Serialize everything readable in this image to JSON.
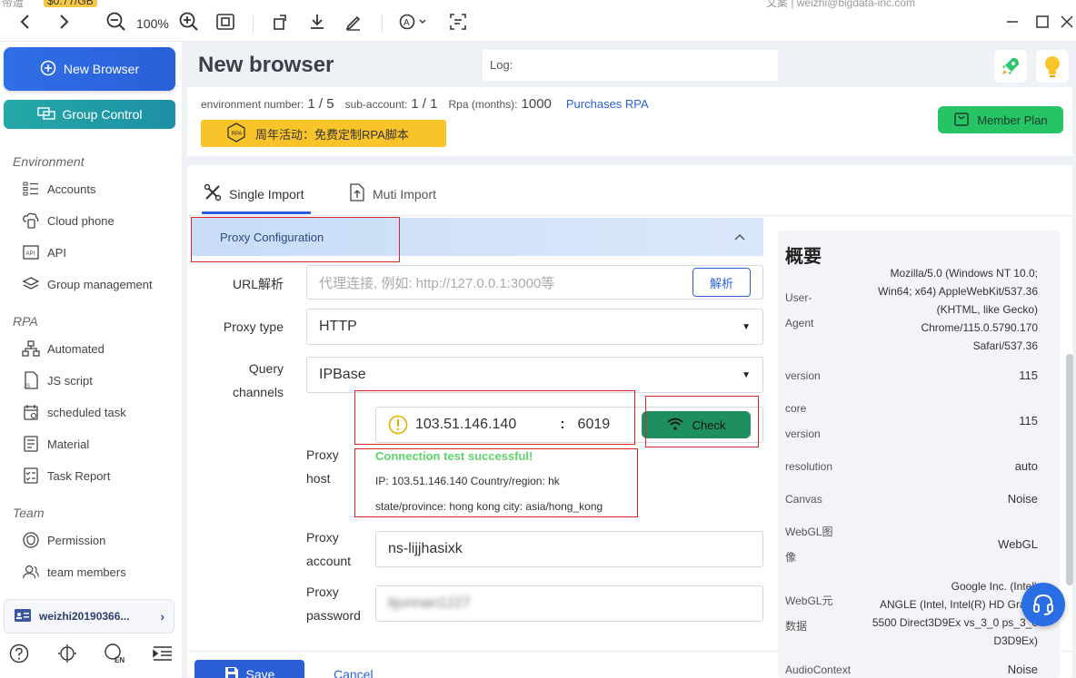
{
  "topbar": {
    "ghost_left": "帝遭",
    "ghost_price": "$0.77/GB",
    "ghost_right": "文案  |  weizhi@bigdata-inc.com",
    "zoom": "100%"
  },
  "sidebar": {
    "new_browser": "New Browser",
    "group_control": "Group Control",
    "sections": {
      "environment": "Environment",
      "rpa": "RPA",
      "team": "Team"
    },
    "items": {
      "accounts": "Accounts",
      "cloud_phone": "Cloud phone",
      "api": "API",
      "group_management": "Group management",
      "automated": "Automated",
      "js_script": "JS script",
      "scheduled_task": "scheduled task",
      "material": "Material",
      "task_report": "Task Report",
      "permission": "Permission",
      "team_members": "team members"
    },
    "user": "weizhi20190366..."
  },
  "header": {
    "title": "New browser",
    "log_label": "Log:"
  },
  "info": {
    "env_label": "environment number:",
    "env_value": "1 / 5",
    "sub_label": "sub-account:",
    "sub_value": "1 / 1",
    "rpa_label": "Rpa (months):",
    "rpa_value": "1000",
    "purchase_link": "Purchases RPA",
    "promo_text": "周年活动：免费定制RPA脚本",
    "member_plan": "Member Plan"
  },
  "tabs": {
    "single": "Single Import",
    "muti": "Muti Import"
  },
  "form": {
    "proxy_config": "Proxy Configuration",
    "url_label": "URL解析",
    "url_placeholder": "代理连接, 例如: http://127.0.0.1:3000等",
    "parse_btn": "解析",
    "proxy_type_label": "Proxy type",
    "proxy_type_value": "HTTP",
    "query_label_1": "Query",
    "query_label_2": "channels",
    "query_value": "IPBase",
    "host_label_1": "Proxy",
    "host_label_2": "host",
    "host_value": "103.51.146.140",
    "port_sep": ":",
    "port_value": "6019",
    "check_btn": "Check",
    "success": "Connection test successful!",
    "result_line_1": "IP: 103.51.146.140 Country/region: hk",
    "result_line_2": "state/province: hong kong city: asia/hong_kong",
    "account_label_1": "Proxy",
    "account_label_2": "account",
    "account_value": "ns-lijjhasixk",
    "password_label_1": "Proxy",
    "password_label_2": "password",
    "password_value": "lijunnan1227",
    "save": "Save",
    "cancel": "Cancel"
  },
  "overview": {
    "title": "概要",
    "ua_key_1": "User-",
    "ua_key_2": "Agent",
    "ua_lines": [
      "Mozilla/5.0 (Windows NT 10.0;",
      "Win64; x64) AppleWebKit/537.36",
      "(KHTML, like Gecko)",
      "Chrome/115.0.5790.170",
      "Safari/537.36"
    ],
    "version_key": "version",
    "version_val": "115",
    "core_key_1": "core",
    "core_key_2": "version",
    "core_val": "115",
    "resolution_key": "resolution",
    "resolution_val": "auto",
    "canvas_key": "Canvas",
    "canvas_val": "Noise",
    "webgl_img_key_1": "WebGL图",
    "webgl_img_key_2": "像",
    "webgl_img_val": "WebGL",
    "webgl_meta_key_1": "WebGL元",
    "webgl_meta_key_2": "数据",
    "webgl_meta_lines": [
      "Google Inc. (Intel)",
      "ANGLE (Intel, Intel(R) HD Graph",
      "5500 Direct3D9Ex vs_3_0 ps_3_0",
      "D3D9Ex)"
    ],
    "audio_key": "AudioContext",
    "audio_val": "Noise"
  }
}
